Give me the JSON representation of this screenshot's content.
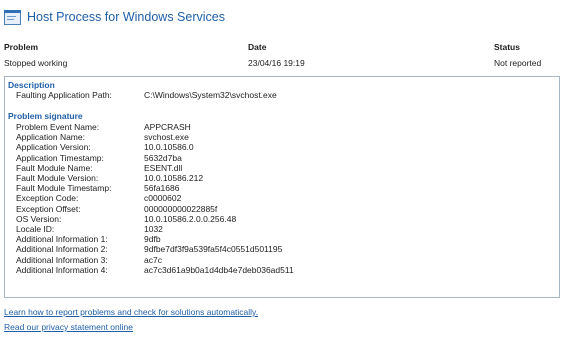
{
  "window": {
    "title": "Host Process for Windows Services"
  },
  "summary": {
    "headers": {
      "problem": "Problem",
      "date": "Date",
      "status": "Status"
    },
    "values": {
      "problem": "Stopped working",
      "date": "23/04/16 19:19",
      "status": "Not reported"
    }
  },
  "description": {
    "title": "Description",
    "rows": [
      {
        "label": "Faulting Application Path:",
        "value": "C:\\Windows\\System32\\svchost.exe"
      }
    ]
  },
  "signature": {
    "title": "Problem signature",
    "rows": [
      {
        "label": "Problem Event Name:",
        "value": "APPCRASH"
      },
      {
        "label": "Application Name:",
        "value": "svchost.exe"
      },
      {
        "label": "Application Version:",
        "value": "10.0.10586.0"
      },
      {
        "label": "Application Timestamp:",
        "value": "5632d7ba"
      },
      {
        "label": "Fault Module Name:",
        "value": "ESENT.dll"
      },
      {
        "label": "Fault Module Version:",
        "value": "10.0.10586.212"
      },
      {
        "label": "Fault Module Timestamp:",
        "value": "56fa1686"
      },
      {
        "label": "Exception Code:",
        "value": "c0000602"
      },
      {
        "label": "Exception Offset:",
        "value": "000000000022885f"
      },
      {
        "label": "OS Version:",
        "value": "10.0.10586.2.0.0.256.48"
      },
      {
        "label": "Locale ID:",
        "value": "1032"
      },
      {
        "label": "Additional Information 1:",
        "value": "9dfb"
      },
      {
        "label": "Additional Information 2:",
        "value": "9dfbe7df3f9a539fa5f4c0551d501195"
      },
      {
        "label": "Additional Information 3:",
        "value": "ac7c"
      },
      {
        "label": "Additional Information 4:",
        "value": "ac7c3d61a9b0a1d4db4e7deb036ad511"
      }
    ]
  },
  "links": {
    "report_help": "Learn how to report problems and check for solutions automatically.",
    "privacy": "Read our privacy statement online"
  },
  "icons": {
    "app": "window-app-icon"
  },
  "colors": {
    "accent": "#1f5fa8",
    "border": "#a9b6c6"
  }
}
